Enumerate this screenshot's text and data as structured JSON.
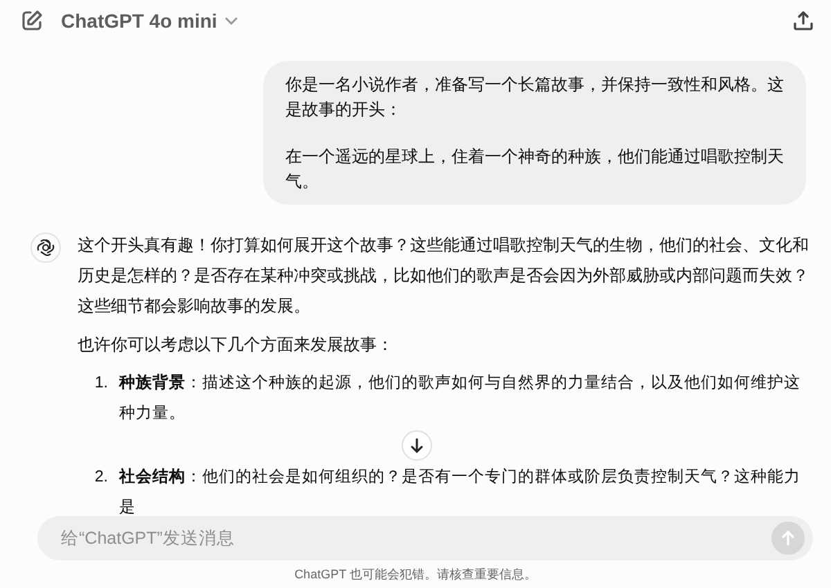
{
  "header": {
    "model": "ChatGPT 4o mini"
  },
  "user_message": {
    "paragraphs": [
      "你是一名小说作者，准备写一个长篇故事，并保持一致性和风格。这是故事的开头：",
      "在一个遥远的星球上，住着一个神奇的种族，他们能通过唱歌控制天气。"
    ]
  },
  "assistant_message": {
    "paragraphs": [
      "这个开头真有趣！你打算如何展开这个故事？这些能通过唱歌控制天气的生物，他们的社会、文化和历史是怎样的？是否存在某种冲突或挑战，比如他们的歌声是否会因为外部威胁或内部问题而失效？这些细节都会影响故事的发展。",
      "也许你可以考虑以下几个方面来发展故事："
    ],
    "list": [
      {
        "number": "1.",
        "text": "**种族背景**：描述这个种族的起源，他们的歌声如何与自然界的力量结合，以及他们如何维护这种力量。"
      },
      {
        "number": "2.",
        "text": "**社会结构**：他们的社会是如何组织的？是否有一个专门的群体或阶层负责控制天气？这种能力是"
      }
    ]
  },
  "composer": {
    "placeholder": "给“ChatGPT”发送消息"
  },
  "footer": "ChatGPT 也可能会犯错。请核查重要信息。"
}
